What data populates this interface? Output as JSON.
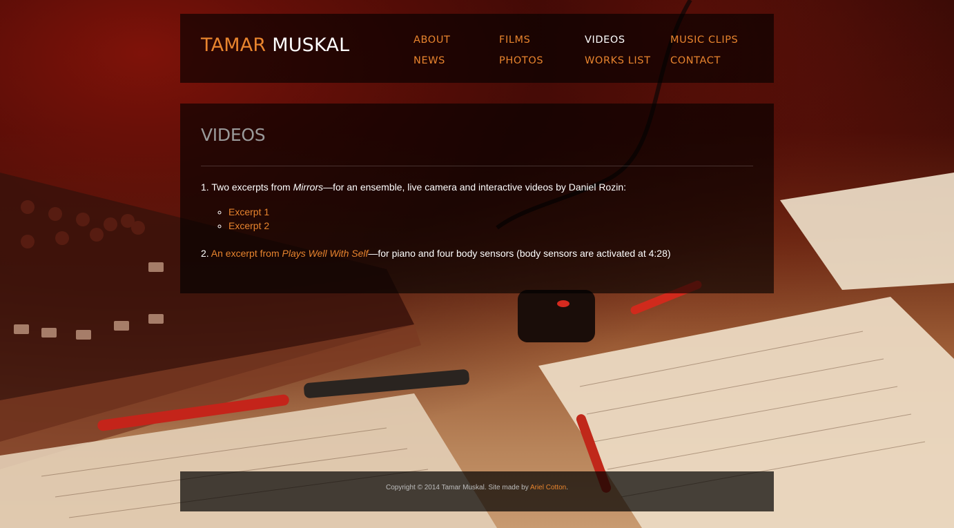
{
  "site": {
    "logo_first": "TAMAR",
    "logo_last": "MUSKAL"
  },
  "nav": {
    "items": [
      {
        "label": "ABOUT",
        "active": false
      },
      {
        "label": "FILMS",
        "active": false
      },
      {
        "label": "VIDEOS",
        "active": true
      },
      {
        "label": "MUSIC CLIPS",
        "active": false
      },
      {
        "label": "NEWS",
        "active": false
      },
      {
        "label": "PHOTOS",
        "active": false
      },
      {
        "label": "WORKS LIST",
        "active": false
      },
      {
        "label": "CONTACT",
        "active": false
      }
    ]
  },
  "main": {
    "title": "VIDEOS",
    "item1": {
      "prefix": "1. Two excerpts from ",
      "work": "Mirrors",
      "suffix": "—for an ensemble, live camera and interactive videos by Daniel Rozin:",
      "links": [
        "Excerpt 1",
        "Excerpt 2"
      ]
    },
    "item2": {
      "prefix": "2. ",
      "link_text": "An excerpt from ",
      "work": "Plays Well With Self",
      "suffix": "—for piano and four body sensors (body sensors are activated at 4:28)"
    }
  },
  "footer": {
    "text": "Copyright © 2014 Tamar Muskal. Site made by ",
    "link": "Ariel Cotton",
    "end": "."
  },
  "colors": {
    "accent": "#e8842e",
    "active_nav": "#ffffff",
    "title": "#9a9a9a"
  }
}
